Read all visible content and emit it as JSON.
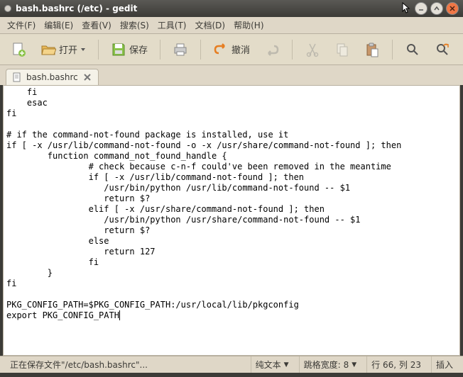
{
  "window": {
    "title": "bash.bashrc (/etc) - gedit"
  },
  "menu": {
    "file": "文件(F)",
    "edit": "编辑(E)",
    "view": "查看(V)",
    "search": "搜索(S)",
    "tools": "工具(T)",
    "documents": "文档(D)",
    "help": "帮助(H)"
  },
  "toolbar": {
    "open": "打开",
    "save": "保存",
    "undo": "撤消"
  },
  "tab": {
    "filename": "bash.bashrc"
  },
  "editor": {
    "content": "    fi\n    esac\nfi\n\n# if the command-not-found package is installed, use it\nif [ -x /usr/lib/command-not-found -o -x /usr/share/command-not-found ]; then\n\tfunction command_not_found_handle {\n\t        # check because c-n-f could've been removed in the meantime\n                if [ -x /usr/lib/command-not-found ]; then\n\t\t   /usr/bin/python /usr/lib/command-not-found -- $1\n                   return $?\n                elif [ -x /usr/share/command-not-found ]; then\n\t\t   /usr/bin/python /usr/share/command-not-found -- $1\n                   return $?\n\t\telse\n\t\t   return 127\n\t\tfi\n\t}\nfi\n\nPKG_CONFIG_PATH=$PKG_CONFIG_PATH:/usr/local/lib/pkgconfig\nexport PKG_CONFIG_PATH"
  },
  "status": {
    "saving": "正在保存文件\"/etc/bash.bashrc\"...",
    "plaintext": "纯文本",
    "tabwidth_label": "跳格宽度:",
    "tabwidth_value": "8",
    "line_col": "行 66, 列 23",
    "insert": "插入"
  }
}
